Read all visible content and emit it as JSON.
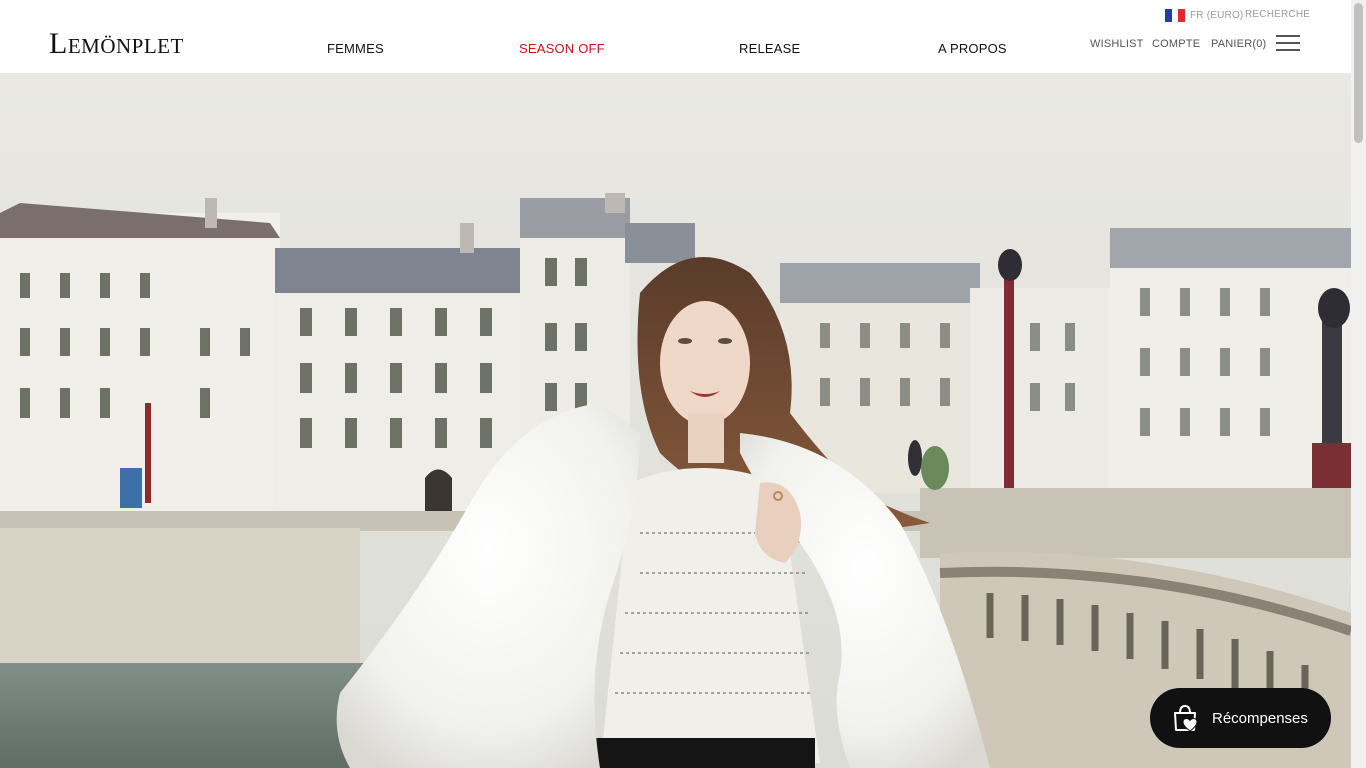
{
  "header": {
    "logo": "Lemönplet",
    "nav": [
      {
        "label": "FEMMES"
      },
      {
        "label": "SEASON OFF"
      },
      {
        "label": "RELEASE"
      },
      {
        "label": "A PROPOS"
      }
    ],
    "locale_label": "FR (EURO)",
    "search_label": "RECHERCHE",
    "wishlist_label": "WISHLIST",
    "account_label": "COMPTE",
    "cart_label": "PANIER(0)",
    "highlight_color": "#cf1020"
  },
  "rewards": {
    "label": "Récompenses"
  }
}
